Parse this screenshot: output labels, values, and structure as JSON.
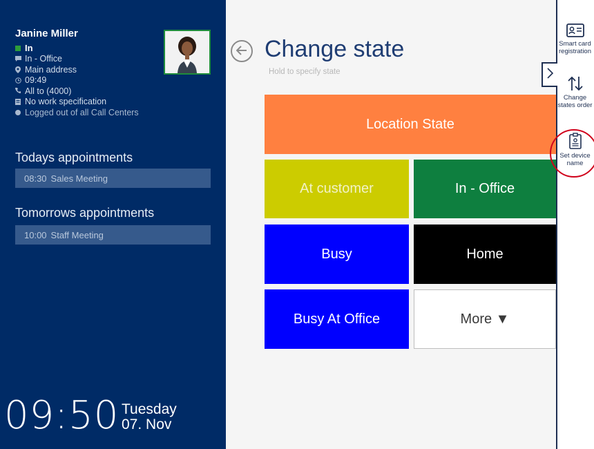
{
  "user": {
    "name": "Janine Miller",
    "statuses": [
      {
        "icon": "green-square-icon",
        "text": "In"
      },
      {
        "icon": "chat-bubble-icon",
        "text": "In - Office"
      },
      {
        "icon": "location-pin-icon",
        "text": "Main address"
      },
      {
        "icon": "clock-icon",
        "text": "09:49"
      },
      {
        "icon": "phone-icon",
        "text": "All to (4000)"
      },
      {
        "icon": "document-icon",
        "text": "No work specification"
      },
      {
        "icon": "gray-dot-icon",
        "text": "Logged out of all Call Centers"
      }
    ]
  },
  "appointments": {
    "today_title": "Todays appointments",
    "today": [
      {
        "time": "08:30",
        "title": "Sales Meeting"
      }
    ],
    "tomorrow_title": "Tomorrows appointments",
    "tomorrow": [
      {
        "time": "10:00",
        "title": "Staff Meeting"
      }
    ]
  },
  "clock": {
    "time": "09:50",
    "weekday": "Tuesday",
    "date": "07. Nov"
  },
  "main": {
    "title": "Change state",
    "hint": "Hold to specify state",
    "tiles": {
      "location": "Location State",
      "at_customer": "At customer",
      "in_office": "In - Office",
      "busy": "Busy",
      "home": "Home",
      "busy_at_office": "Busy At Office",
      "more": "More ▼"
    }
  },
  "toolbar": {
    "smart_card": "Smart card registration",
    "change_order": "Change states order",
    "set_device": "Set device name"
  },
  "colors": {
    "panel": "#002b66",
    "location": "#ff8040",
    "at_customer": "#cccc00",
    "in_office": "#0e7f3f",
    "busy": "#0000ff",
    "home": "#000000",
    "highlight": "#d0021b"
  }
}
